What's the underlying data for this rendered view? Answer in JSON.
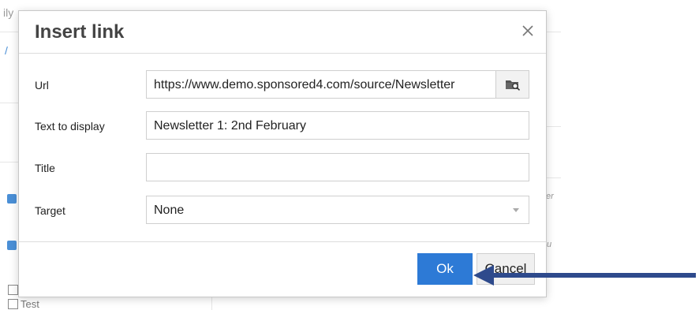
{
  "background": {
    "fragment_top": "ily",
    "fragment_left": "/",
    "fragment_right_1": "er",
    "fragment_right_2": "u",
    "checkbox_label": "Test"
  },
  "dialog": {
    "title": "Insert link",
    "fields": {
      "url": {
        "label": "Url",
        "value": "https://www.demo.sponsored4.com/source/Newsletter"
      },
      "text_to_display": {
        "label": "Text to display",
        "value": "Newsletter 1: 2nd February"
      },
      "title": {
        "label": "Title",
        "value": ""
      },
      "target": {
        "label": "Target",
        "value": "None"
      }
    },
    "buttons": {
      "ok": "Ok",
      "cancel": "Cancel"
    }
  },
  "colors": {
    "primary_button": "#2d7ad6",
    "annotation_arrow": "#2e4a8c"
  },
  "icons": {
    "close": "close-icon",
    "browse": "folder-search-icon",
    "dropdown": "chevron-down-icon"
  }
}
